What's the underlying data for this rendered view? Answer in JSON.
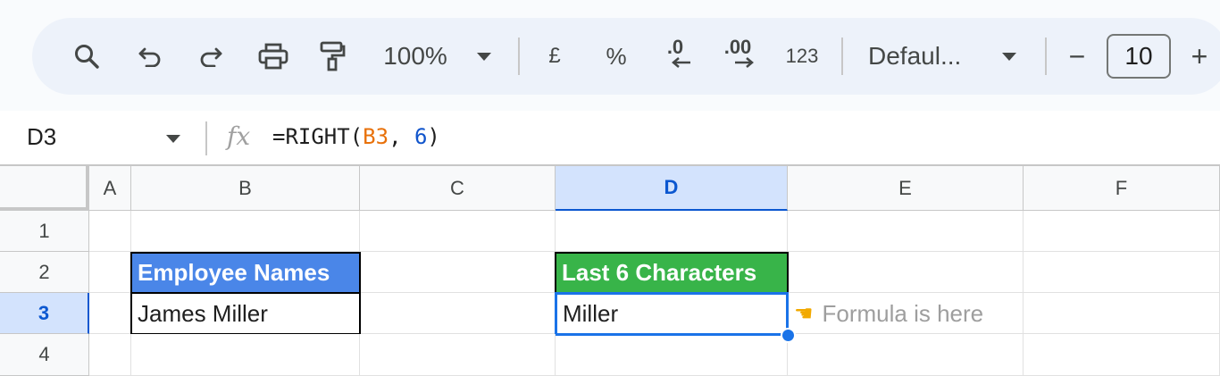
{
  "toolbar": {
    "zoom": "100%",
    "currency": "£",
    "percent": "%",
    "decrease_decimal": ".0",
    "increase_decimal": ".00",
    "number_format": "123",
    "font_family": "Defaul...",
    "font_size": "10",
    "minus": "−",
    "plus": "+",
    "icons": [
      "search-icon",
      "undo-icon",
      "redo-icon",
      "print-icon",
      "paint-format-icon",
      "chevron-down-icon",
      "arrow-left-icon",
      "arrow-right-icon"
    ]
  },
  "formula_bar": {
    "name_box": "D3",
    "fx": "fx",
    "formula_prefix": "=RIGHT(",
    "formula_ref": "B3",
    "formula_sep": ", ",
    "formula_num": "6",
    "formula_suffix": ")"
  },
  "columns": [
    "A",
    "B",
    "C",
    "D",
    "E",
    "F"
  ],
  "rows": [
    "1",
    "2",
    "3",
    "4"
  ],
  "cells": {
    "B2": "Employee Names",
    "D2": "Last 6 Characters",
    "B3": "James Miller",
    "D3": "Miller"
  },
  "annotation": {
    "icon": "pointing-hand-icon",
    "text": "Formula is here"
  },
  "colors": {
    "header_blue": "#4a86e8",
    "header_green": "#38b449",
    "selection_blue": "#1a73e8",
    "ref_orange": "#e8710a",
    "number_blue": "#1155cc"
  }
}
